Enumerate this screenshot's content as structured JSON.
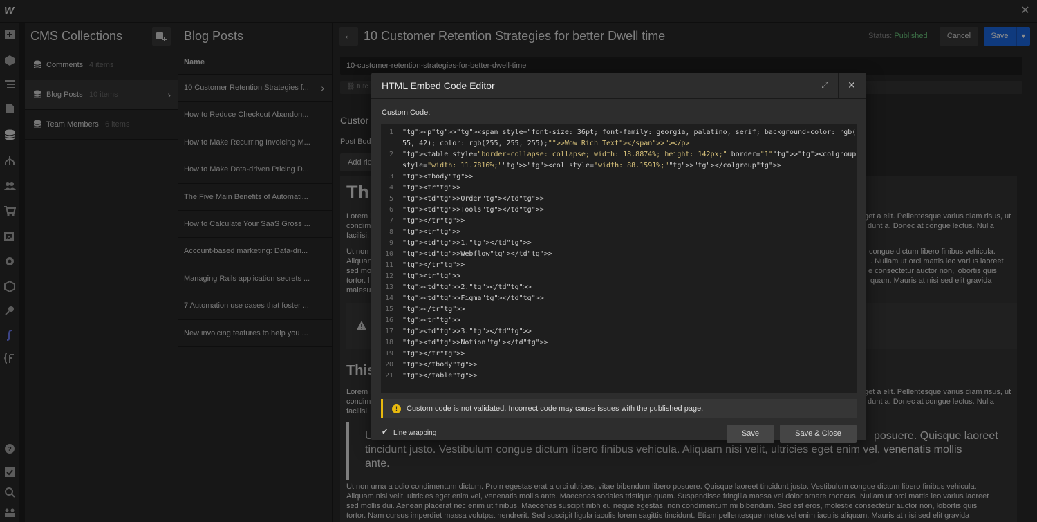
{
  "app": {
    "logo": "W"
  },
  "cms": {
    "title": "CMS Collections",
    "collections": [
      {
        "name": "Comments",
        "count": "4 items"
      },
      {
        "name": "Blog Posts",
        "count": "10 items"
      },
      {
        "name": "Team Members",
        "count": "6 items"
      }
    ]
  },
  "posts": {
    "title": "Blog Posts",
    "column": "Name",
    "items": [
      "10 Customer Retention Strategies f...",
      "How to Reduce Checkout Abandon...",
      "How to Make Recurring Invoicing M...",
      "How to Make Data-driven Pricing D...",
      "The Five Main Benefits of Automati...",
      "How to Calculate Your SaaS Gross ...",
      "Account-based marketing: Data-dri...",
      "Managing Rails application secrets ...",
      "7 Automation use cases that foster ...",
      "New invoicing features to help you ..."
    ]
  },
  "editor": {
    "title": "10 Customer Retention Strategies for better Dwell time",
    "status_label": "Status:",
    "status_value": "Published",
    "cancel": "Cancel",
    "save": "Save",
    "slug": "10-customer-retention-strategies-for-better-dwell-time",
    "link_prefix": "tutc",
    "section": "Custor",
    "field_label": "Post Bod",
    "add_button": "Add ric",
    "heading1": "Th",
    "heading2": "This",
    "paragraphs": [
      {
        "left": "Lorem i",
        "right": "get a elit. Pellentesque varius diam risus, ut"
      },
      {
        "left": "condim",
        "right": "dunt a. Donec at congue lectus. Nulla"
      },
      {
        "left": "facilisi.",
        "right": ""
      },
      {
        "left": "Ut non",
        "right": "congue dictum libero finibus vehicula."
      },
      {
        "left": "Aliquan",
        "right": ". Nullam ut orci mattis leo varius laoreet"
      },
      {
        "left": "sed mo",
        "right": "e consectetur auctor non, lobortis quis"
      },
      {
        "left": "tortor. l",
        "right": "quam. Mauris at nisi sed elit gravida"
      },
      {
        "left": "malesu",
        "right": ""
      }
    ],
    "paragraphs2": [
      {
        "left": "Lorem i",
        "right": "get a elit. Pellentesque varius diam risus, ut"
      },
      {
        "left": "condim",
        "right": "dunt a. Donec at congue lectus. Nulla"
      },
      {
        "left": "facilisi.",
        "right": ""
      }
    ],
    "quote_line1_left": "Ut",
    "quote_line1_right": "posuere. Quisque laoreet",
    "quote_line2": "tincidunt justo. Vestibulum congue dictum libero finibus vehicula. Aliquam nisi velit, ultricies eget enim vel, venenatis mollis",
    "quote_line3": "ante.",
    "bottom_lines": [
      "Ut non urna a odio condimentum dictum. Proin egestas erat a orci ultrices, vitae bibendum libero posuere. Quisque laoreet tincidunt justo. Vestibulum congue dictum libero finibus vehicula.",
      "Aliquam nisi velit, ultricies eget enim vel, venenatis mollis ante. Maecenas sodales tristique quam. Suspendisse fringilla massa vel dolor ornare rhoncus. Nullam ut orci mattis leo varius laoreet",
      "sed mollis dui. Aenean placerat nec enim ut finibus. Maecenas suscipit nibh eu neque egestas, non condimentum mi bibendum. Sed est eros, molestie consectetur auctor non, lobortis quis",
      "tortor. Nam cursus imperdiet massa volutpat hendrerit. Sed suscipit ligula iaculis lorem sagittis tincidunt. Etiam pellentesque metus vel enim iaculis aliquam. Mauris at nisi sed elit gravida"
    ]
  },
  "modal": {
    "title": "HTML Embed Code Editor",
    "code_label": "Custom Code:",
    "warning": "Custom code is not validated. Incorrect code may cause issues with the published page.",
    "line_wrapping": "Line wrapping",
    "save": "Save",
    "save_close": "Save & Close",
    "code_lines": [
      {
        "n": "1",
        "t": "<p><span style=\"font-size: 36pt; font-family: georgia, palatino, serif; background-color: rgb(186,"
      },
      {
        "n": "",
        "t": "55, 42); color: rgb(255, 255, 255);\">Wow Rich Text</span></p>"
      },
      {
        "n": "2",
        "t": "<table style=\"border-collapse: collapse; width: 18.8874%; height: 142px;\" border=\"1\"><colgroup><col"
      },
      {
        "n": "",
        "t": "style=\"width: 11.7816%;\"><col style=\"width: 88.1591%;\"></colgroup>"
      },
      {
        "n": "3",
        "t": "<tbody>"
      },
      {
        "n": "4",
        "t": "<tr>"
      },
      {
        "n": "5",
        "t": "<td>Order</td>"
      },
      {
        "n": "6",
        "t": "<td>Tools</td>"
      },
      {
        "n": "7",
        "t": "</tr>"
      },
      {
        "n": "8",
        "t": "<tr>"
      },
      {
        "n": "9",
        "t": "<td>1.</td>"
      },
      {
        "n": "10",
        "t": "<td>Webflow</td>"
      },
      {
        "n": "11",
        "t": "</tr>"
      },
      {
        "n": "12",
        "t": "<tr>"
      },
      {
        "n": "13",
        "t": "<td>2.</td>"
      },
      {
        "n": "14",
        "t": "<td>Figma</td>"
      },
      {
        "n": "15",
        "t": "</tr>"
      },
      {
        "n": "16",
        "t": "<tr>"
      },
      {
        "n": "17",
        "t": "<td>3.</td>"
      },
      {
        "n": "18",
        "t": "<td>Notion</td>"
      },
      {
        "n": "19",
        "t": "</tr>"
      },
      {
        "n": "20",
        "t": "</tbody>"
      },
      {
        "n": "21",
        "t": "</table>"
      }
    ]
  },
  "rail_icons": [
    "add-icon",
    "cube-icon",
    "navigator-icon",
    "pages-icon",
    "cms-icon",
    "ecommerce-icon",
    "users-icon",
    "cart-icon",
    "assets-icon",
    "settings-icon",
    "apps-icon",
    "logic-icon",
    "finsweet-icon",
    "code-icon",
    "help-icon",
    "tasks-icon",
    "search-icon",
    "team-icon"
  ]
}
